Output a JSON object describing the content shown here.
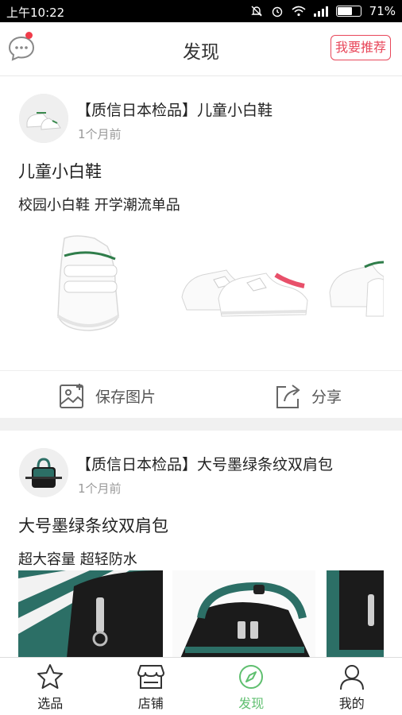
{
  "status_bar": {
    "time": "上午10:22",
    "battery": "71%",
    "battery_level": 0.71
  },
  "header": {
    "title": "发现",
    "recommend_button": "我要推荐"
  },
  "posts": [
    {
      "title": "【质信日本检品】儿童小白鞋",
      "time": "1个月前",
      "name": "儿童小白鞋",
      "desc": "校园小白鞋 开学潮流单品",
      "save_label": "保存图片",
      "share_label": "分享"
    },
    {
      "title": "【质信日本检品】大号墨绿条纹双肩包",
      "time": "1个月前",
      "name": "大号墨绿条纹双肩包",
      "desc": "超大容量 超轻防水"
    }
  ],
  "tabs": [
    {
      "label": "选品",
      "icon": "star-icon"
    },
    {
      "label": "店铺",
      "icon": "store-icon"
    },
    {
      "label": "发现",
      "icon": "compass-icon",
      "active": true
    },
    {
      "label": "我的",
      "icon": "user-icon"
    }
  ],
  "colors": {
    "accent": "#e8475a",
    "active_tab": "#5fbf6f",
    "separator": "#f0f0f0"
  }
}
